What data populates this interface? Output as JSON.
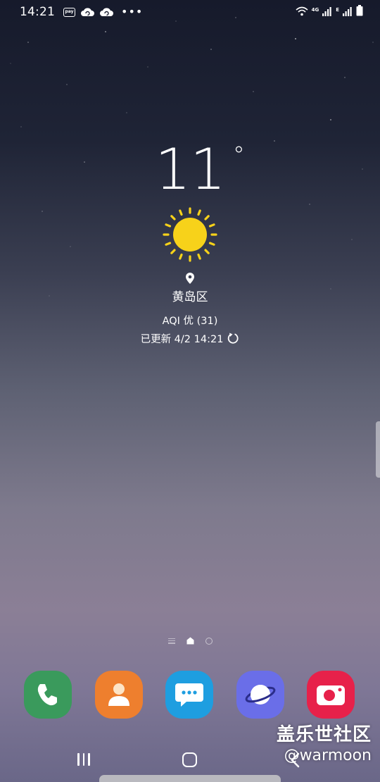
{
  "status_bar": {
    "time": "14:21",
    "left_icons": [
      "pay-icon",
      "cloud-sync-icon",
      "cloud-sync-icon",
      "more-dots-icon"
    ],
    "pay_label": "pay",
    "more": "•••",
    "network_4g": "4G",
    "network_e": "E",
    "right_icons": [
      "wifi-icon",
      "signal-4g-icon",
      "signal-e-icon",
      "battery-icon"
    ]
  },
  "weather": {
    "temperature": "11",
    "degree": "°",
    "condition_icon": "sun-icon",
    "location": "黄岛区",
    "aqi": "AQI 优 (31)",
    "updated": "已更新 4/2 14:21",
    "colors": {
      "sun": "#f7d21a"
    }
  },
  "page_indicator": {
    "pages": [
      "lines-indicator",
      "home-indicator",
      "dot-indicator"
    ],
    "active": "home-indicator"
  },
  "dock": {
    "apps": [
      {
        "name": "phone",
        "icon": "phone-icon",
        "color": "#3a9a5c"
      },
      {
        "name": "contacts",
        "icon": "contacts-icon",
        "color": "#ee7f2e"
      },
      {
        "name": "messages",
        "icon": "messages-icon",
        "color": "#1e9ee0"
      },
      {
        "name": "internet",
        "icon": "internet-icon",
        "color": "#6a6ee8"
      },
      {
        "name": "camera",
        "icon": "camera-icon",
        "color": "#e7214a"
      }
    ]
  },
  "watermark": {
    "title": "盖乐世社区",
    "user": "@warmoon"
  },
  "nav_bar": {
    "buttons": [
      "recents-icon",
      "home-icon",
      "back-icon"
    ]
  }
}
